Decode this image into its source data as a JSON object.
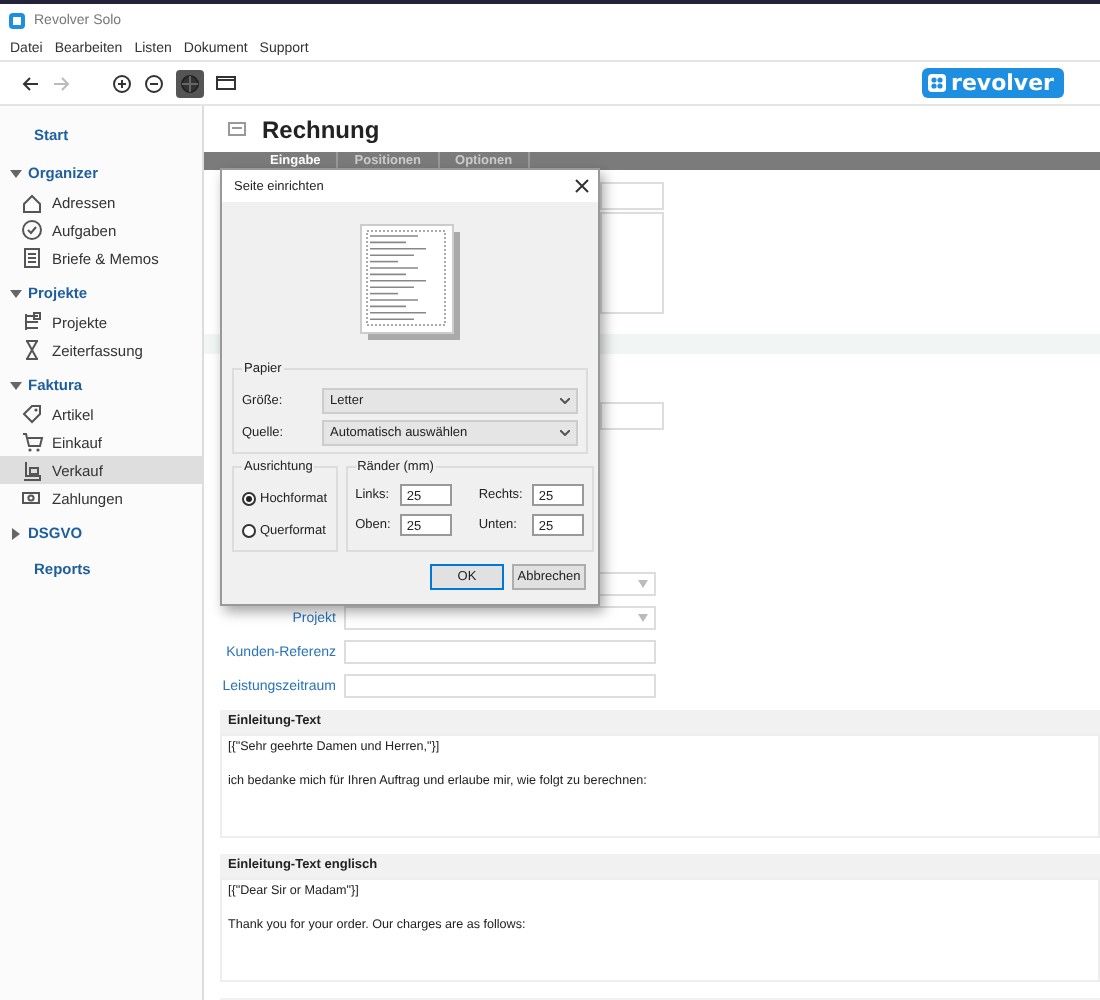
{
  "window": {
    "title": "Revolver Solo"
  },
  "menu": [
    "Datei",
    "Bearbeiten",
    "Listen",
    "Dokument",
    "Support"
  ],
  "logo": {
    "text": "revolver"
  },
  "sidebar": {
    "items": [
      {
        "kind": "link",
        "label": "Start"
      },
      {
        "kind": "group",
        "label": "Organizer",
        "expanded": true,
        "children": [
          {
            "label": "Adressen",
            "selected": false
          },
          {
            "label": "Aufgaben",
            "selected": false
          },
          {
            "label": "Briefe & Memos",
            "selected": false
          }
        ]
      },
      {
        "kind": "group",
        "label": "Projekte",
        "expanded": true,
        "children": [
          {
            "label": "Projekte",
            "selected": false
          },
          {
            "label": "Zeiterfassung",
            "selected": false
          }
        ]
      },
      {
        "kind": "group",
        "label": "Faktura",
        "expanded": true,
        "children": [
          {
            "label": "Artikel",
            "selected": false
          },
          {
            "label": "Einkauf",
            "selected": false
          },
          {
            "label": "Verkauf",
            "selected": true
          },
          {
            "label": "Zahlungen",
            "selected": false
          }
        ]
      },
      {
        "kind": "group",
        "label": "DSGVO",
        "expanded": false
      },
      {
        "kind": "link",
        "label": "Reports"
      }
    ]
  },
  "document": {
    "title": "Rechnung",
    "tabs": [
      {
        "label": "Eingabe",
        "selected": true
      },
      {
        "label": "Positionen",
        "selected": false
      },
      {
        "label": "Optionen",
        "selected": false
      }
    ]
  },
  "form": {
    "fields": [
      {
        "kind": "dropdown"
      },
      {
        "kind": "dropdown",
        "label": "Projekt"
      },
      {
        "kind": "text",
        "label": "Kunden-Referenz"
      },
      {
        "kind": "text",
        "label": "Leistungszeitraum"
      }
    ]
  },
  "sections": [
    {
      "title": "Einleitung-Text",
      "paragraphs": [
        "[{\"Sehr geehrte Damen und Herren,\"}]",
        "ich bedanke mich für Ihren Auftrag und erlaube mir, wie folgt zu berechnen:"
      ]
    },
    {
      "title": "Einleitung-Text englisch",
      "paragraphs": [
        "[{\"Dear Sir or Madam\"}]",
        "Thank you for your order. Our charges are as follows:"
      ]
    }
  ],
  "dialog": {
    "title": "Seite einrichten",
    "paper": {
      "legend": "Papier",
      "size_label": "Größe:",
      "size": "Letter",
      "source_label": "Quelle:",
      "source": "Automatisch auswählen"
    },
    "orientation": {
      "legend": "Ausrichtung",
      "options": [
        {
          "label": "Hochformat",
          "selected": true
        },
        {
          "label": "Querformat",
          "selected": false
        }
      ]
    },
    "margins": {
      "legend": "Ränder (mm)",
      "fields": [
        {
          "label": "Links:",
          "value": "25"
        },
        {
          "label": "Rechts:",
          "value": "25"
        },
        {
          "label": "Oben:",
          "value": "25"
        },
        {
          "label": "Unten:",
          "value": "25"
        }
      ]
    },
    "buttons": [
      {
        "label": "OK",
        "default": true
      },
      {
        "label": "Abbrechen",
        "default": false
      }
    ]
  }
}
